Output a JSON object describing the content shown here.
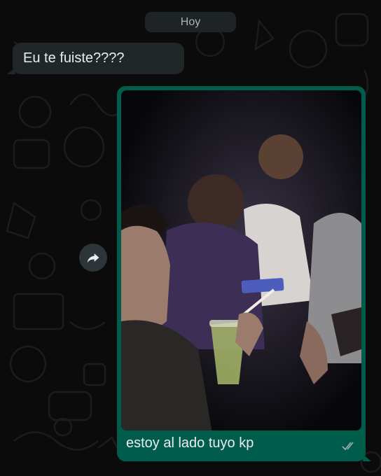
{
  "chat": {
    "date_separator": "Hoy",
    "incoming": {
      "text": "Eu te fuiste????"
    },
    "outgoing": {
      "caption": "estoy al lado tuyo kp",
      "status": "read-double-check-icon"
    }
  },
  "icons": {
    "forward": "forward-arrow-icon",
    "status": "double-check-icon"
  },
  "colors": {
    "background": "#0b0b0b",
    "incoming_bubble": "#212728",
    "outgoing_bubble": "#005c4b",
    "text": "#e9edef"
  }
}
